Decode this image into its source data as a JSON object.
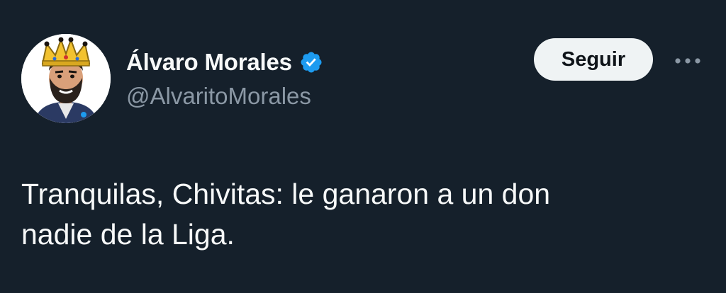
{
  "author": {
    "display_name": "Álvaro Morales",
    "handle": "@AlvaritoMorales",
    "verified": true,
    "avatar_icon": "caricature-avatar-with-crown",
    "verified_icon": "verified-badge-icon"
  },
  "actions": {
    "follow_label": "Seguir",
    "more_icon": "more-options-icon"
  },
  "tweet": {
    "text": "Tranquilas, Chivitas: le ganaron a un don\nnadie de la Liga."
  },
  "colors": {
    "background": "#15202b",
    "primary_text": "#f7f9f9",
    "secondary_text": "#8b98a5",
    "verified_blue": "#1d9bf0",
    "follow_button_bg": "#eff3f4",
    "follow_button_text": "#0f1419"
  }
}
